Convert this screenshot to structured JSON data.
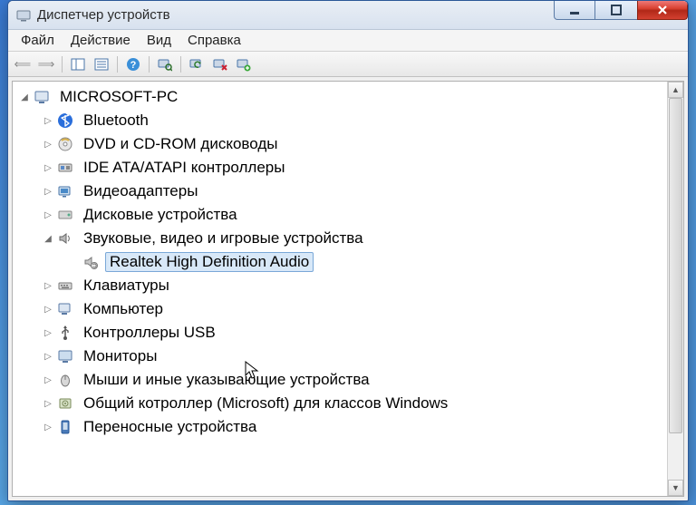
{
  "window": {
    "title": "Диспетчер устройств"
  },
  "menu": {
    "file": "Файл",
    "action": "Действие",
    "view": "Вид",
    "help": "Справка"
  },
  "tree": {
    "root": "MICROSOFT-PC",
    "items": [
      {
        "label": "Bluetooth"
      },
      {
        "label": "DVD и CD-ROM дисководы"
      },
      {
        "label": "IDE ATA/ATAPI контроллеры"
      },
      {
        "label": "Видеоадаптеры"
      },
      {
        "label": "Дисковые устройства"
      },
      {
        "label": "Звуковые, видео и игровые устройства"
      },
      {
        "label": "Клавиатуры"
      },
      {
        "label": "Компьютер"
      },
      {
        "label": "Контроллеры USB"
      },
      {
        "label": "Мониторы"
      },
      {
        "label": "Мыши и иные указывающие устройства"
      },
      {
        "label": "Общий котроллер (Microsoft) для классов Windows"
      },
      {
        "label": "Переносные устройства"
      }
    ],
    "selected_child": "Realtek High Definition Audio"
  }
}
